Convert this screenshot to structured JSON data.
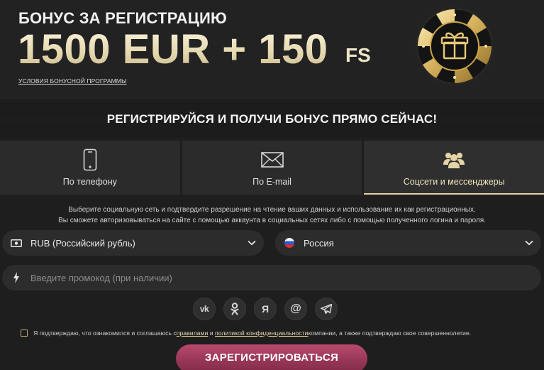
{
  "banner": {
    "title": "БОНУС ЗА РЕГИСТРАЦИЮ",
    "amount": "1500 EUR + 150",
    "fs": "FS",
    "terms_link": "УСЛОВИЯ БОНУСНОЙ ПРОГРАММЫ",
    "chip_icon": "gift-poker-chip-icon"
  },
  "tagline": "РЕГИСТРИРУЙСЯ И ПОЛУЧИ БОНУС ПРЯМО СЕЙЧАС!",
  "tabs": [
    {
      "label": "По телефону",
      "icon": "phone-icon",
      "active": false
    },
    {
      "label": "По E-mail",
      "icon": "envelope-icon",
      "active": false
    },
    {
      "label": "Соцсети и мессенджеры",
      "icon": "users-icon",
      "active": true
    }
  ],
  "info": {
    "line1": "Выберите социальную сеть и подтвердите разрешение на чтение ваших данных и использование их как регистрационных.",
    "line2": "Вы сможете авторизовываться на сайте с помощью аккаунта в социальных сетях либо с помощью полученного логина и пароля."
  },
  "currency": {
    "value": "RUB (Российский рубль)",
    "icon": "banknote-icon"
  },
  "country": {
    "value": "Россия",
    "icon": "russia-flag-icon"
  },
  "promo": {
    "placeholder": "Введите промокод (при наличии)",
    "value": "",
    "icon": "lightning-icon"
  },
  "socials": [
    {
      "name": "vk",
      "glyph": "vk"
    },
    {
      "name": "odnoklassniki",
      "glyph": "ok"
    },
    {
      "name": "yandex",
      "glyph": "Я"
    },
    {
      "name": "mail",
      "glyph": "@"
    },
    {
      "name": "telegram",
      "glyph": "tg"
    }
  ],
  "agreement": {
    "text_before": "Я подтверждаю, что ознакомился и соглашаюсь с ",
    "rules_link": "правилами",
    "and": " и ",
    "privacy_link": "политикой конфиденциальности",
    "text_after": " компании, а также подтверждаю свое совершеннолетие."
  },
  "register_button": "ЗАРЕГИСТРИРОВАТЬСЯ",
  "colors": {
    "background": "#1e1e1f",
    "gold": "#e2d4a6",
    "button": "#963556"
  }
}
